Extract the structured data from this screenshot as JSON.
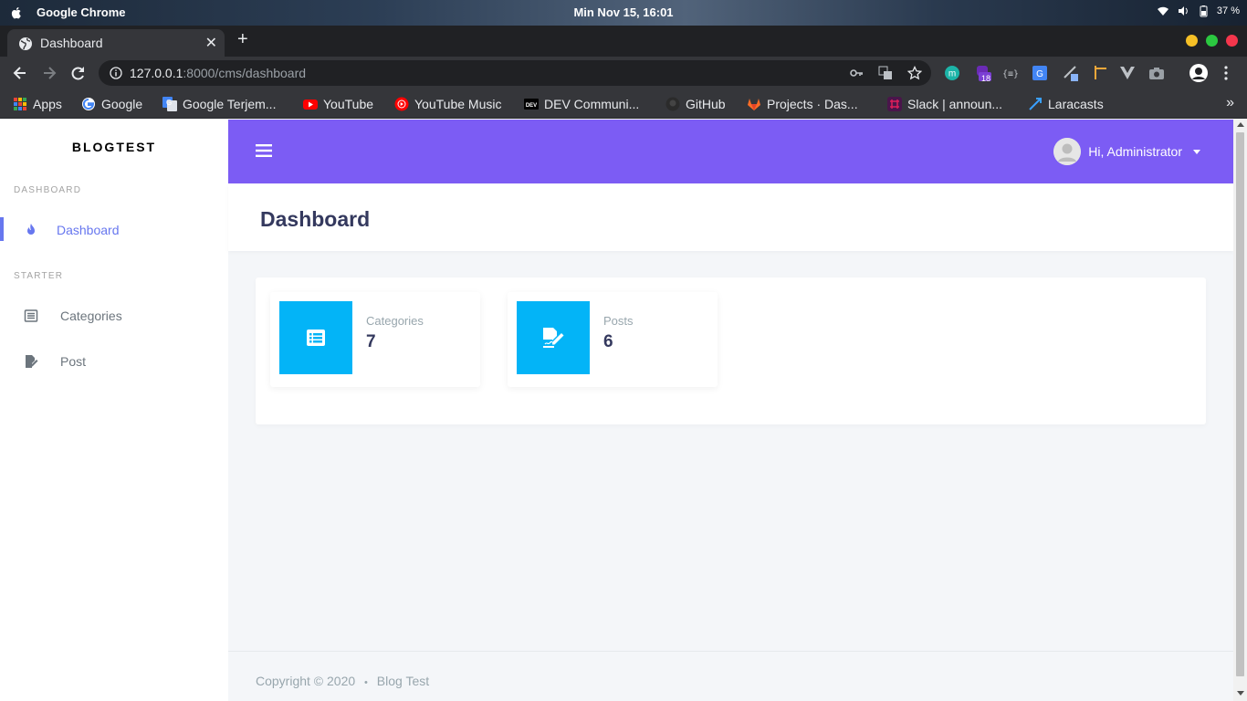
{
  "os": {
    "app_name": "Google Chrome",
    "clock": "Min Nov 15, 16:01",
    "battery": "37 %"
  },
  "browser": {
    "tab_title": "Dashboard",
    "url_host": "127.0.0.1",
    "url_path": ":8000/cms/dashboard",
    "extension_badge": "18",
    "bookmarks": [
      {
        "label": "Apps",
        "icon": "apps-grid-icon"
      },
      {
        "label": "Google",
        "icon": "google-icon"
      },
      {
        "label": "Google Terjem...",
        "icon": "google-translate-icon"
      },
      {
        "label": "YouTube",
        "icon": "youtube-icon"
      },
      {
        "label": "YouTube Music",
        "icon": "youtube-music-icon"
      },
      {
        "label": "DEV Communi...",
        "icon": "dev-icon"
      },
      {
        "label": "GitHub",
        "icon": "github-icon"
      },
      {
        "label": "Projects · Das...",
        "icon": "gitlab-icon"
      },
      {
        "label": "Slack | announ...",
        "icon": "slack-icon"
      },
      {
        "label": "Laracasts",
        "icon": "laracasts-icon"
      }
    ],
    "bookmarks_more": "»"
  },
  "sidebar": {
    "brand": "BLOGTEST",
    "sections": [
      {
        "header": "DASHBOARD",
        "items": [
          {
            "label": "Dashboard",
            "icon": "fire-icon",
            "active": true
          }
        ]
      },
      {
        "header": "STARTER",
        "items": [
          {
            "label": "Categories",
            "icon": "list-icon",
            "active": false
          },
          {
            "label": "Post",
            "icon": "file-signature-icon",
            "active": false
          }
        ]
      }
    ]
  },
  "navbar": {
    "greeting": "Hi, Administrator"
  },
  "main": {
    "title": "Dashboard",
    "stats": [
      {
        "label": "Categories",
        "value": "7",
        "icon": "list-alt-icon"
      },
      {
        "label": "Posts",
        "value": "6",
        "icon": "file-signature-icon"
      }
    ]
  },
  "footer": {
    "copyright": "Copyright © 2020",
    "separator": "•",
    "site": "Blog Test"
  },
  "colors": {
    "primary": "#6777ef",
    "navbar": "#7c5cf4",
    "stat_icon_bg": "#03b4f7",
    "title": "#34395e"
  }
}
